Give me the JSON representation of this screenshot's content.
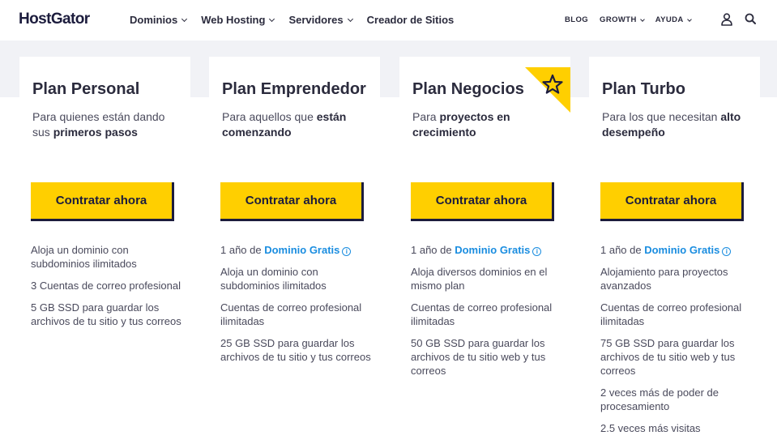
{
  "header": {
    "logo": "HostGator",
    "nav": [
      {
        "label": "Dominios",
        "has_dropdown": true
      },
      {
        "label": "Web Hosting",
        "has_dropdown": true
      },
      {
        "label": "Servidores",
        "has_dropdown": true
      },
      {
        "label": "Creador de Sitios",
        "has_dropdown": false
      }
    ],
    "right_nav": [
      {
        "label": "BLOG",
        "has_dropdown": false
      },
      {
        "label": "GROWTH",
        "has_dropdown": true
      },
      {
        "label": "AYUDA",
        "has_dropdown": true
      }
    ],
    "icons": [
      "user-icon",
      "search-icon"
    ]
  },
  "colors": {
    "accent": "#ffcf00",
    "dark": "#1c1c3d",
    "link": "#1a8de0",
    "band": "#f1f2f6"
  },
  "plans": [
    {
      "title": "Plan Personal",
      "desc_pre": "Para quienes están dando sus ",
      "desc_bold": "primeros pasos",
      "desc_post": "",
      "cta": "Contratar ahora",
      "featured": false,
      "domain": null,
      "features": [
        "Aloja un dominio con subdominios ilimitados",
        "3 Cuentas de correo profesional",
        "5 GB SSD para guardar los archivos de tu sitio y tus correos"
      ]
    },
    {
      "title": "Plan Emprendedor",
      "desc_pre": "Para aquellos que ",
      "desc_bold": "están comenzando",
      "desc_post": "",
      "cta": "Contratar ahora",
      "featured": false,
      "domain": {
        "pre": "1 año de ",
        "link": "Dominio Gratis",
        "info": "i"
      },
      "features": [
        "Aloja un dominio con subdominios ilimitados",
        "Cuentas de correo profesional ilimitadas",
        "25 GB SSD para guardar los archivos de tu sitio y tus correos"
      ]
    },
    {
      "title": "Plan Negocios",
      "desc_pre": "Para ",
      "desc_bold": "proyectos en crecimiento",
      "desc_post": "",
      "cta": "Contratar ahora",
      "featured": true,
      "domain": {
        "pre": "1 año de ",
        "link": "Dominio Gratis",
        "info": "i"
      },
      "features": [
        "Aloja diversos dominios en el mismo plan",
        "Cuentas de correo profesional ilimitadas",
        "50 GB SSD para guardar los archivos de tu sitio web y tus correos"
      ]
    },
    {
      "title": "Plan Turbo",
      "desc_pre": "Para los que necesitan ",
      "desc_bold": "alto desempeño",
      "desc_post": "",
      "cta": "Contratar ahora",
      "featured": false,
      "domain": {
        "pre": "1 año de ",
        "link": "Dominio Gratis",
        "info": "i"
      },
      "features": [
        "Alojamiento para proyectos avanzados",
        "Cuentas de correo profesional ilimitadas",
        "75 GB SSD para guardar los archivos de tu sitio web y tus correos",
        "2 veces más de poder de procesamiento",
        "2.5 veces más visitas"
      ]
    }
  ]
}
